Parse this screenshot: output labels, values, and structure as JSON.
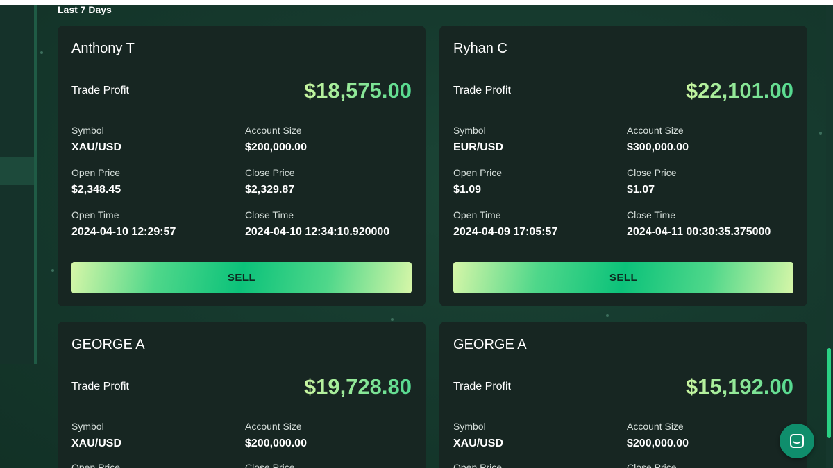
{
  "section": {
    "label": "Last 7 Days"
  },
  "cards": [
    {
      "name": "Anthony T",
      "profit_label": "Trade Profit",
      "profit_value": "$18,575.00",
      "symbol_label": "Symbol",
      "symbol": "XAU/USD",
      "account_label": "Account Size",
      "account": "$200,000.00",
      "open_price_label": "Open Price",
      "open_price": "$2,348.45",
      "close_price_label": "Close Price",
      "close_price": "$2,329.87",
      "open_time_label": "Open Time",
      "open_time": "2024-04-10 12:29:57",
      "close_time_label": "Close Time",
      "close_time": "2024-04-10 12:34:10.920000",
      "action_label": "SELL"
    },
    {
      "name": "Ryhan C",
      "profit_label": "Trade Profit",
      "profit_value": "$22,101.00",
      "symbol_label": "Symbol",
      "symbol": "EUR/USD",
      "account_label": "Account Size",
      "account": "$300,000.00",
      "open_price_label": "Open Price",
      "open_price": "$1.09",
      "close_price_label": "Close Price",
      "close_price": "$1.07",
      "open_time_label": "Open Time",
      "open_time": "2024-04-09 17:05:57",
      "close_time_label": "Close Time",
      "close_time": "2024-04-11 00:30:35.375000",
      "action_label": "SELL"
    },
    {
      "name": "GEORGE A",
      "profit_label": "Trade Profit",
      "profit_value": "$19,728.80",
      "symbol_label": "Symbol",
      "symbol": "XAU/USD",
      "account_label": "Account Size",
      "account": "$200,000.00",
      "open_price_label": "Open Price",
      "close_price_label": "Close Price"
    },
    {
      "name": "GEORGE A",
      "profit_label": "Trade Profit",
      "profit_value": "$15,192.00",
      "symbol_label": "Symbol",
      "symbol": "XAU/USD",
      "account_label": "Account Size",
      "account": "$200,000.00",
      "open_price_label": "Open Price",
      "close_price_label": "Close Price"
    }
  ],
  "icons": {
    "chat": "chat-icon"
  },
  "colors": {
    "accent": "#2ad184",
    "profit": "#7be7a0",
    "card_bg": "#172622",
    "page_bg": "#16372d"
  }
}
